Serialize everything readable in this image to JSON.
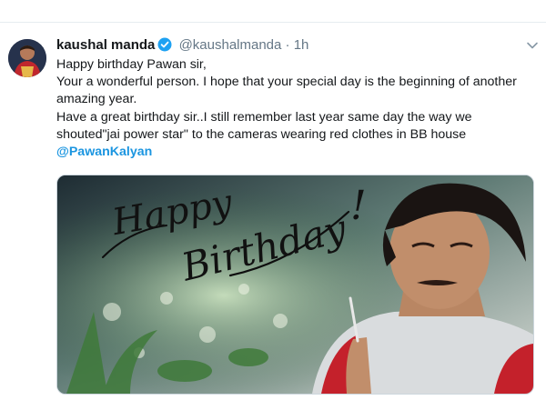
{
  "tweet": {
    "author_name": "kaushal manda",
    "handle": "@kaushalmanda",
    "separator": "·",
    "time": "1h",
    "lines": [
      "Happy birthday Pawan sir,",
      "Your a wonderful person. I hope that your special day is the beginning of another amazing year.",
      "Have a great birthday sir..I still remember last year same day the way we shouted\"jai power star\" to the cameras wearing red clothes in BB house"
    ],
    "mention": "@PawanKalyan",
    "image": {
      "caption_word1": "Happy",
      "caption_word2": "Birthday"
    }
  },
  "colors": {
    "link": "#1b95e0",
    "muted": "#657786",
    "verified": "#1da1f2"
  }
}
